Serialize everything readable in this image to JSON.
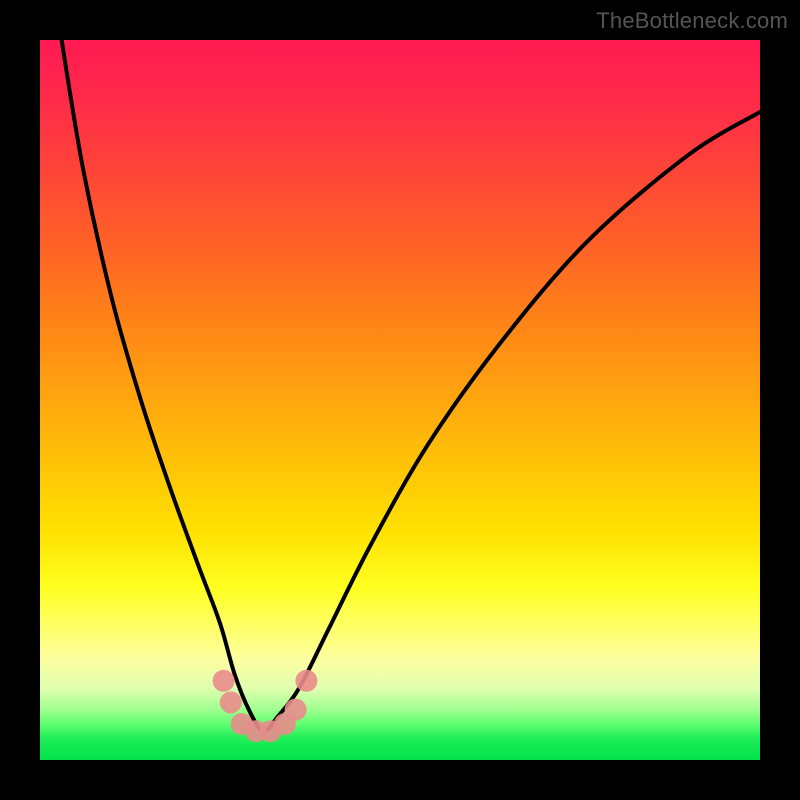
{
  "watermark": "TheBottleneck.com",
  "chart_data": {
    "type": "line",
    "title": "",
    "xlabel": "",
    "ylabel": "",
    "xlim": [
      0,
      100
    ],
    "ylim": [
      0,
      100
    ],
    "grid": false,
    "legend": false,
    "notes": "Axes untitled and unscaled. Vertical gradient represents bottleneck severity: top (red) = high, bottom (green) = low. Black curve is a V-shaped valley with minimum near x≈31 at y≈4. Pink dot markers cluster around the valley floor.",
    "series": [
      {
        "name": "bottleneck-curve",
        "color": "#000000",
        "x": [
          3,
          6,
          10,
          14,
          18,
          22,
          25,
          27,
          29,
          31,
          33,
          36,
          40,
          46,
          54,
          64,
          76,
          90,
          100
        ],
        "y": [
          100,
          82,
          64,
          50,
          38,
          27,
          19,
          12,
          7,
          4,
          6,
          10,
          18,
          30,
          44,
          58,
          72,
          84,
          90
        ]
      },
      {
        "name": "valley-points",
        "type": "scatter",
        "color": "#e98c8c",
        "x": [
          25.5,
          26.5,
          28,
          30,
          32,
          34,
          35.5,
          37
        ],
        "y": [
          11,
          8,
          5,
          4,
          4,
          5,
          7,
          11
        ]
      }
    ]
  }
}
